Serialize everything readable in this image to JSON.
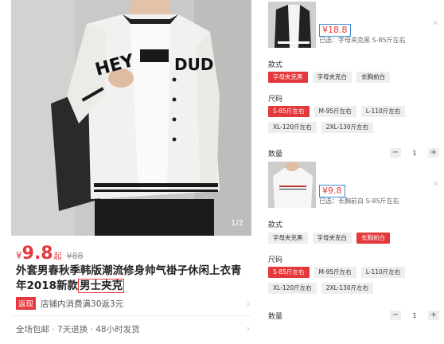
{
  "product": {
    "image_pager": "1/2",
    "currency": "¥",
    "price": "9.8",
    "price_suffix": "起",
    "original_price": "¥88",
    "title_main": "外套男春秋季韩版潮流修身帅气褂子休闲上衣青年2018新款",
    "title_highlight": "男士夹克",
    "promo_badge": "返现",
    "promo_text": "店铺内消费满30返3元",
    "service_text": "全场包邮 · 7天退换 · 48小时发货",
    "arrow": "›",
    "shirt_print": "HEY DUDE"
  },
  "panel_top": {
    "price": "¥18.8",
    "selected": "已选：字母夹克黑 S-85斤左右",
    "close": "×",
    "style_label": "款式",
    "style_options": [
      "字母夹克黑",
      "字母夹克白",
      "长胸前白"
    ],
    "size_label": "尺码",
    "size_options": [
      "S-85斤左右",
      "M-95斤左右",
      "L-110斤左右",
      "XL-120斤左右",
      "2XL-130斤左右"
    ],
    "qty_label": "数量",
    "qty_minus": "−",
    "qty_value": "1",
    "qty_plus": "+"
  },
  "panel_bottom": {
    "price": "¥9.8",
    "selected": "已选：长胸前白 S-85斤左右",
    "close": "×",
    "style_label": "款式",
    "style_options": [
      "字母夹克黑",
      "字母夹克白",
      "长胸前白"
    ],
    "size_label": "尺码",
    "size_options": [
      "S-85斤左右",
      "M-95斤左右",
      "L-110斤左右",
      "XL-120斤左右",
      "2XL-130斤左右"
    ],
    "qty_label": "数量",
    "qty_minus": "−",
    "qty_value": "1",
    "qty_plus": "+"
  },
  "colors": {
    "accent": "#e4393c",
    "highlight_border": "#3a8bd6"
  }
}
